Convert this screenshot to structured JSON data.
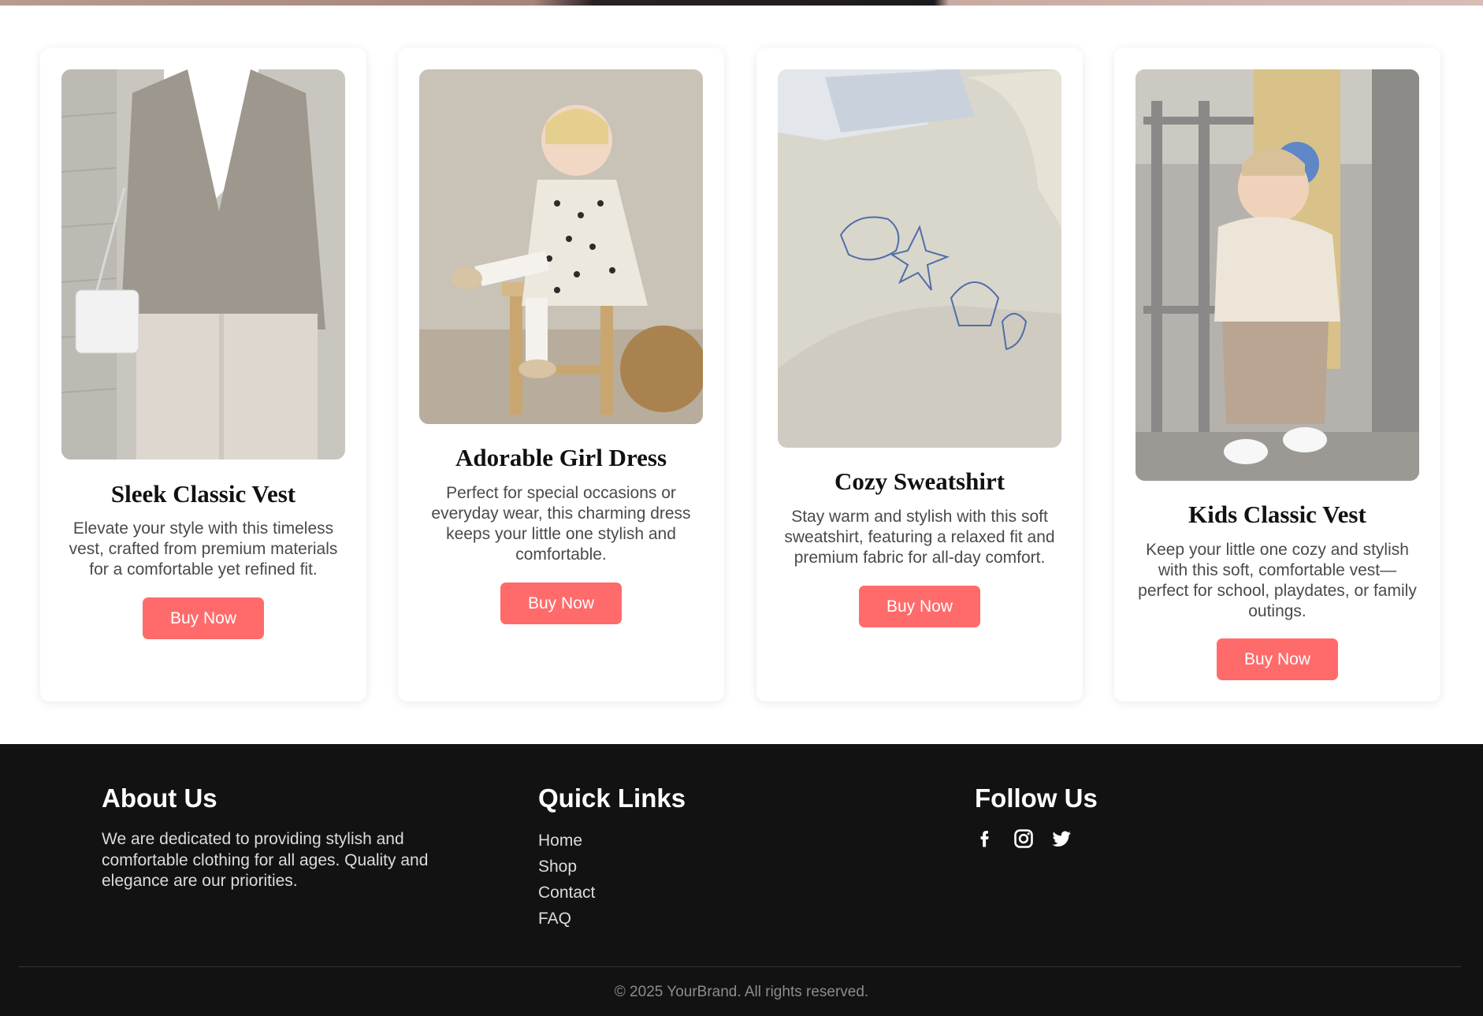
{
  "colors": {
    "accent": "#ff6b6b",
    "footer_bg": "#121212",
    "card_bg": "#ffffff"
  },
  "products": [
    {
      "title": "Sleek Classic Vest",
      "description": "Elevate your style with this timeless vest, crafted from premium materials for a comfortable yet refined fit.",
      "button": "Buy Now"
    },
    {
      "title": "Adorable Girl Dress",
      "description": "Perfect for special occasions or everyday wear, this charming dress keeps your little one stylish and comfortable.",
      "button": "Buy Now"
    },
    {
      "title": "Cozy Sweatshirt",
      "description": "Stay warm and stylish with this soft sweatshirt, featuring a relaxed fit and premium fabric for all-day comfort.",
      "button": "Buy Now"
    },
    {
      "title": "Kids Classic Vest",
      "description": "Keep your little one cozy and stylish with this soft, comfortable vest—perfect for school, playdates, or family outings.",
      "button": "Buy Now"
    }
  ],
  "footer": {
    "about": {
      "heading": "About Us",
      "text": "We are dedicated to providing stylish and comfortable clothing for all ages. Quality and elegance are our priorities."
    },
    "quick_links": {
      "heading": "Quick Links",
      "items": [
        "Home",
        "Shop",
        "Contact",
        "FAQ"
      ]
    },
    "follow": {
      "heading": "Follow Us",
      "icons": [
        "facebook-icon",
        "instagram-icon",
        "twitter-icon"
      ]
    },
    "copyright": "© 2025 YourBrand. All rights reserved."
  }
}
